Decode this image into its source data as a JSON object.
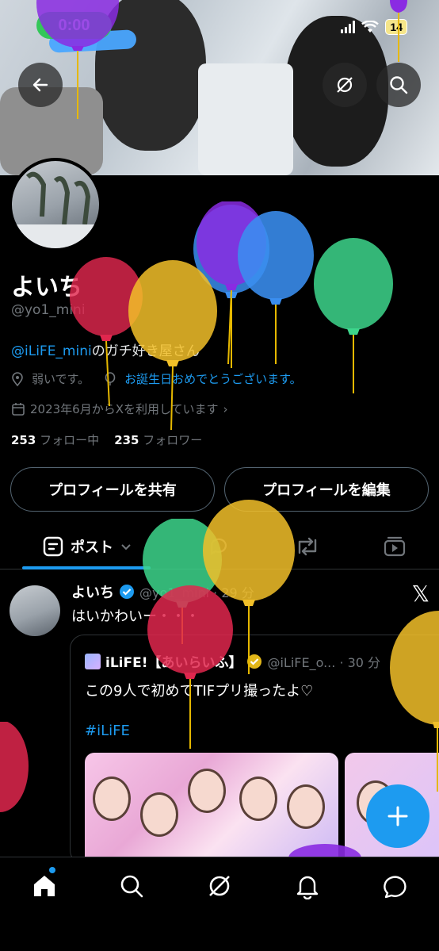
{
  "status_bar": {
    "time": "0:00",
    "battery": "14"
  },
  "profile": {
    "display_name": "よいち",
    "handle": "@yo1_mini",
    "bio_mention": "@iLiFE_mini",
    "bio_text": "のガチ好き屋さん",
    "location": "弱いです。",
    "birthday_text": "お誕生日おめでとうございます。",
    "joined": "2023年6月からXを利用しています",
    "following_count": "253",
    "following_label": "フォロー中",
    "followers_count": "235",
    "followers_label": "フォロワー"
  },
  "actions": {
    "share": "プロフィールを共有",
    "edit": "プロフィールを編集"
  },
  "tabs": {
    "posts": "ポスト"
  },
  "post": {
    "author": "よいち",
    "handle_time": "@yo1_mini · 29 分",
    "text": "はいかわいー・・・",
    "quote": {
      "author": "iLiFE!【あいらいふ】",
      "handle_time": "@iLiFE_o... · 30 分",
      "text": "この9人で初めてTIFプリ撮ったよ♡",
      "hashtag": "#iLiFE"
    }
  },
  "icons": [
    "back-arrow-icon",
    "grok-icon",
    "search-icon",
    "avatar",
    "verified-icon",
    "location-icon",
    "balloon-icon",
    "calendar-icon",
    "posts-icon",
    "chevron-down-icon",
    "repost-icon",
    "video-icon",
    "x-logo-icon",
    "plus-icon",
    "home-icon",
    "bell-icon",
    "messages-icon"
  ],
  "colors": {
    "accent": "#1d9bf0",
    "background": "#000000",
    "status_time": "#34c759"
  }
}
